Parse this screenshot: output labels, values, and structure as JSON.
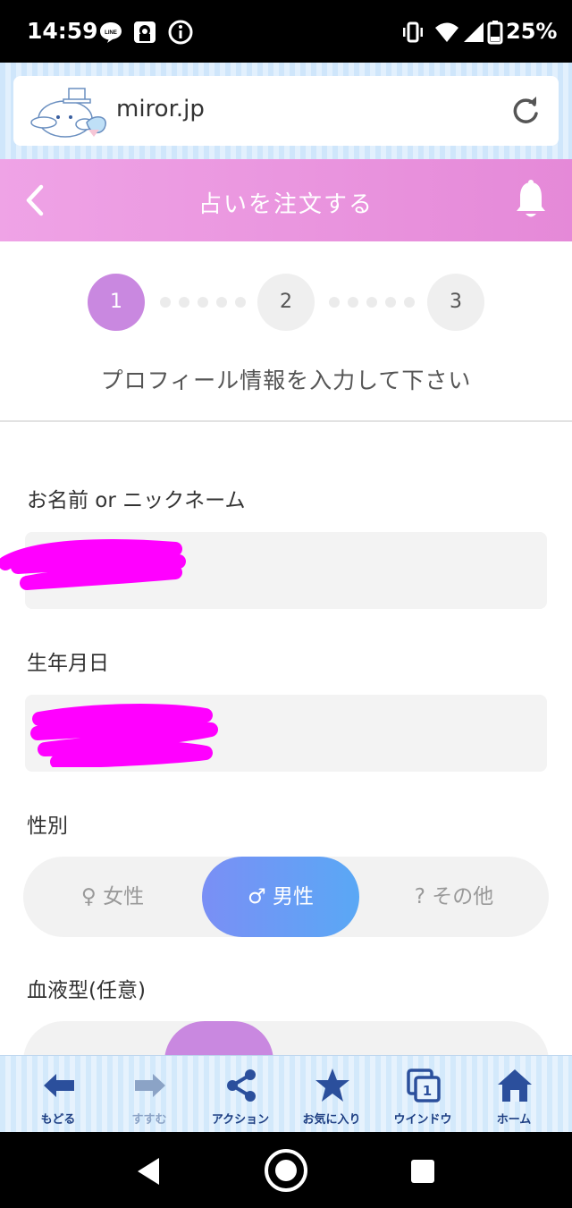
{
  "status_bar": {
    "time": "14:59",
    "battery": "25%",
    "left_icons": [
      "line-app-icon",
      "profile-notification-icon",
      "info-icon"
    ],
    "right_icons": [
      "vibrate-icon",
      "wifi-icon",
      "signal-icon",
      "battery-icon"
    ]
  },
  "browser": {
    "url": "miror.jp",
    "mascot": "cinnamoroll-mascot-icon",
    "reload_icon": "reload-icon"
  },
  "header": {
    "title": "占いを注文する",
    "back_icon": "chevron-left-icon",
    "bell_icon": "bell-icon",
    "bg_colors": [
      "#efa3e6",
      "#e589d8"
    ]
  },
  "steps": {
    "items": [
      "1",
      "2",
      "3"
    ],
    "current": "1",
    "active_color": "#c988e0",
    "instruction": "プロフィール情報を入力して下さい"
  },
  "form": {
    "name_label": "お名前 or ニックネーム",
    "birth_label": "生年月日",
    "gender_label": "性別",
    "gender_options": [
      "♀ 女性",
      "♂ 男性",
      "? その他"
    ],
    "gender_selected": "♂ 男性",
    "blood_label": "血液型(任意)",
    "redaction_color": "#ff00ff"
  },
  "toolbar": {
    "items": [
      {
        "label": "もどる",
        "icon": "arrow-left-icon"
      },
      {
        "label": "すすむ",
        "icon": "arrow-right-icon"
      },
      {
        "label": "アクション",
        "icon": "share-icon"
      },
      {
        "label": "お気に入り",
        "icon": "star-icon"
      },
      {
        "label": "ウインドウ",
        "icon": "window-icon",
        "badge": "1"
      },
      {
        "label": "ホーム",
        "icon": "home-icon"
      }
    ],
    "accent": "#2b4f9c"
  },
  "navbar": {
    "icons": [
      "back-triangle-icon",
      "home-circle-icon",
      "recents-square-icon"
    ]
  }
}
